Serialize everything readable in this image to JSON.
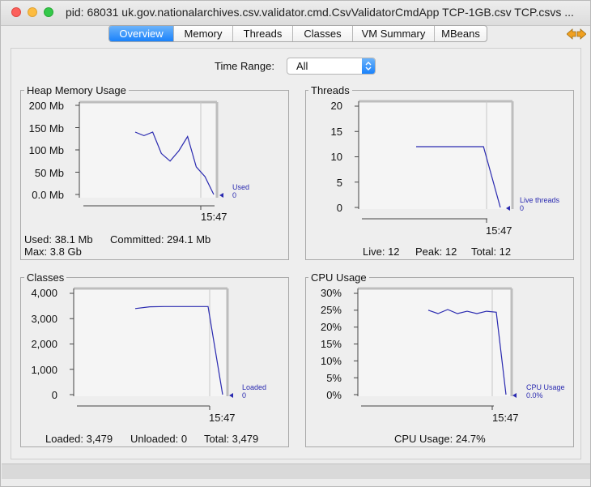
{
  "window": {
    "title": "pid: 68031 uk.gov.nationalarchives.csv.validator.cmd.CsvValidatorCmdApp TCP-1GB.csv TCP.csvs ..."
  },
  "tabs": [
    {
      "label": "Overview",
      "active": true
    },
    {
      "label": "Memory",
      "active": false
    },
    {
      "label": "Threads",
      "active": false
    },
    {
      "label": "Classes",
      "active": false
    },
    {
      "label": "VM Summary",
      "active": false
    },
    {
      "label": "MBeans",
      "active": false
    }
  ],
  "time_range": {
    "label": "Time Range:",
    "value": "All"
  },
  "colors": {
    "series": "#2a2ab0",
    "accent": "#1a82fb"
  },
  "panels": {
    "heap": {
      "title": "Heap Memory Usage",
      "yticks": [
        "200 Mb",
        "150 Mb",
        "100 Mb",
        "50 Mb",
        "0.0 Mb"
      ],
      "time": "15:47",
      "legend_name": "Used",
      "legend_value": "0",
      "stats": {
        "used": "Used: 38.1 Mb",
        "committed": "Committed: 294.1 Mb",
        "max": "Max: 3.8 Gb"
      }
    },
    "threads": {
      "title": "Threads",
      "yticks": [
        "20",
        "15",
        "10",
        "5",
        "0"
      ],
      "time": "15:47",
      "legend_name": "Live threads",
      "legend_value": "0",
      "stats": {
        "live": "Live: 12",
        "peak": "Peak: 12",
        "total": "Total: 12"
      }
    },
    "classes": {
      "title": "Classes",
      "yticks": [
        "4,000",
        "3,000",
        "2,000",
        "1,000",
        "0"
      ],
      "time": "15:47",
      "legend_name": "Loaded",
      "legend_value": "0",
      "stats": {
        "loaded": "Loaded: 3,479",
        "unloaded": "Unloaded: 0",
        "total": "Total: 3,479"
      }
    },
    "cpu": {
      "title": "CPU Usage",
      "yticks": [
        "30%",
        "25%",
        "20%",
        "15%",
        "10%",
        "5%",
        "0%"
      ],
      "time": "15:47",
      "legend_name": "CPU Usage",
      "legend_value": "0.0%",
      "stats": {
        "usage": "CPU Usage: 24.7%"
      }
    }
  },
  "chart_data": [
    {
      "type": "line",
      "title": "Heap Memory Usage",
      "ylim": [
        0,
        200
      ],
      "series": [
        {
          "name": "Used",
          "values": [
            140,
            132,
            140,
            92,
            75,
            98,
            130,
            62,
            40,
            0
          ]
        }
      ]
    },
    {
      "type": "line",
      "title": "Threads",
      "ylim": [
        0,
        20
      ],
      "series": [
        {
          "name": "Live threads",
          "values": [
            12,
            12,
            12,
            12,
            12,
            0
          ]
        }
      ]
    },
    {
      "type": "line",
      "title": "Classes",
      "ylim": [
        0,
        4000
      ],
      "series": [
        {
          "name": "Loaded",
          "values": [
            3400,
            3470,
            3479,
            3479,
            3479,
            3479,
            0
          ]
        }
      ]
    },
    {
      "type": "line",
      "title": "CPU Usage",
      "ylim": [
        0,
        30
      ],
      "series": [
        {
          "name": "CPU Usage",
          "values": [
            25,
            24,
            25.2,
            24,
            24.7,
            24,
            24.7,
            24.4,
            0
          ]
        }
      ]
    }
  ]
}
